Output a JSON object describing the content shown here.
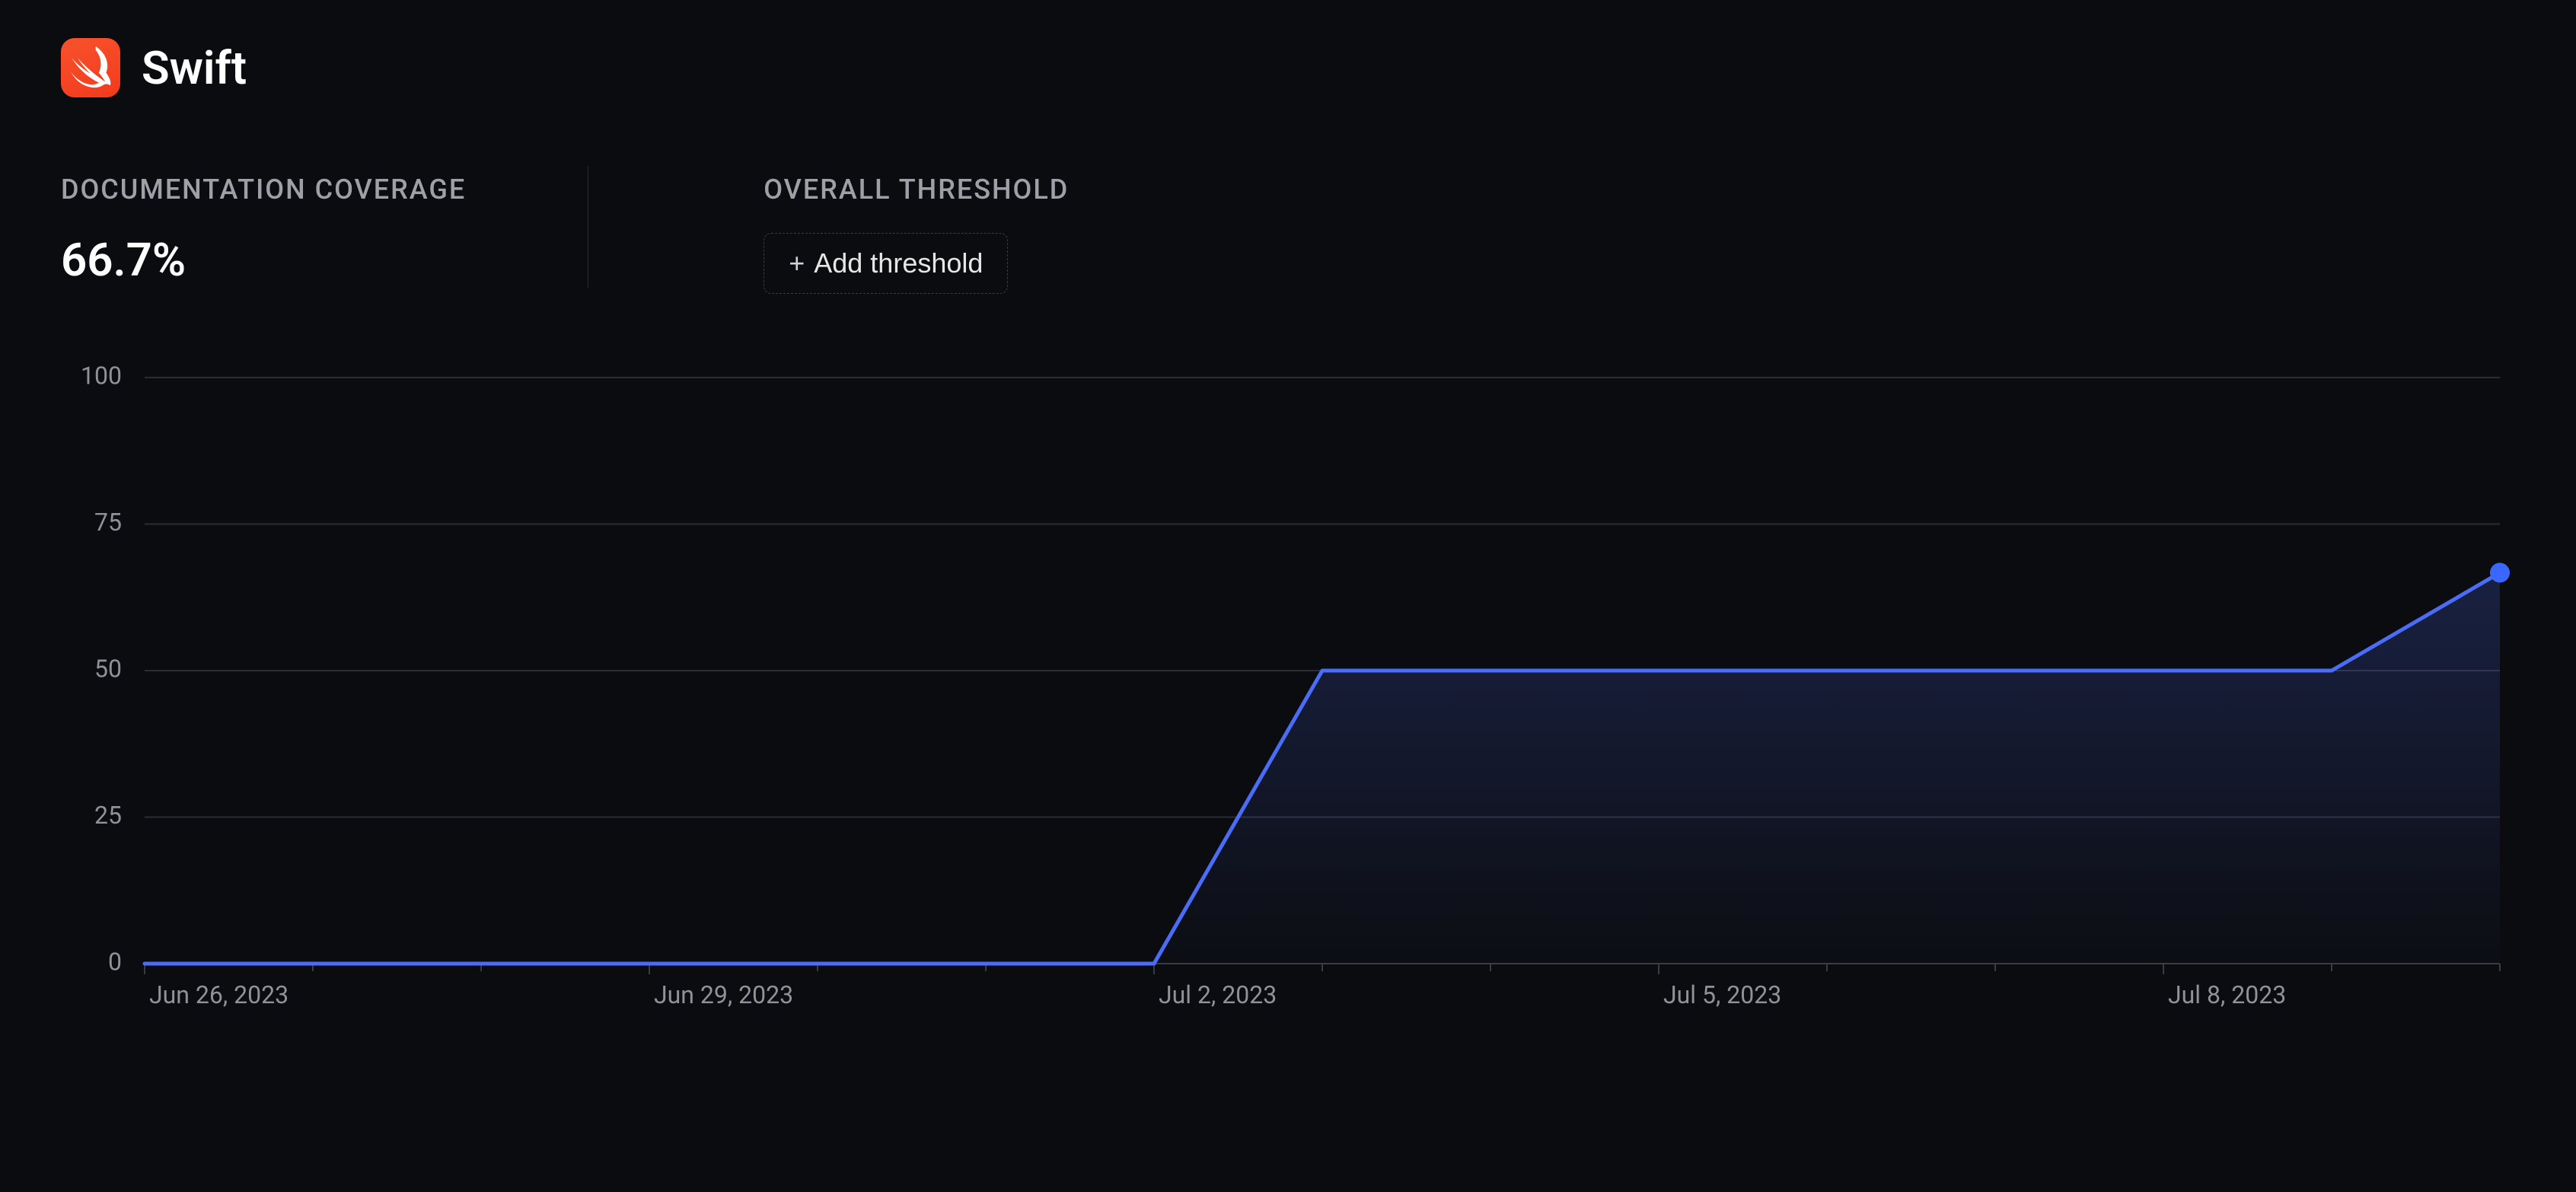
{
  "header": {
    "title": "Swift",
    "logo_icon": "swift-icon"
  },
  "stats": {
    "coverage_label": "DOCUMENTATION COVERAGE",
    "coverage_value": "66.7%",
    "threshold_label": "OVERALL THRESHOLD",
    "add_threshold_button": "Add threshold",
    "add_threshold_plus": "+"
  },
  "colors": {
    "background": "#0b0c0f",
    "accent": "#4a6cf7",
    "swift_logo": "#f7532c",
    "text_muted": "#9da0a6",
    "grid": "#2b2d33"
  },
  "chart_data": {
    "type": "area",
    "title": "",
    "xlabel": "",
    "ylabel": "",
    "ylim": [
      0,
      100
    ],
    "y_ticks": [
      0,
      25,
      50,
      75,
      100
    ],
    "x_categories": [
      "Jun 26, 2023",
      "Jun 29, 2023",
      "Jul 2, 2023",
      "Jul 5, 2023",
      "Jul 8, 2023"
    ],
    "series": [
      {
        "name": "Documentation Coverage",
        "x": [
          "Jun 26, 2023",
          "Jun 27, 2023",
          "Jun 28, 2023",
          "Jun 29, 2023",
          "Jun 30, 2023",
          "Jul 1, 2023",
          "Jul 2, 2023",
          "Jul 3, 2023",
          "Jul 4, 2023",
          "Jul 5, 2023",
          "Jul 6, 2023",
          "Jul 7, 2023",
          "Jul 8, 2023",
          "Jul 9, 2023",
          "Jul 10, 2023"
        ],
        "values": [
          0,
          0,
          0,
          0,
          0,
          0,
          0,
          50,
          50,
          50,
          50,
          50,
          50,
          50,
          66.7
        ]
      }
    ]
  }
}
